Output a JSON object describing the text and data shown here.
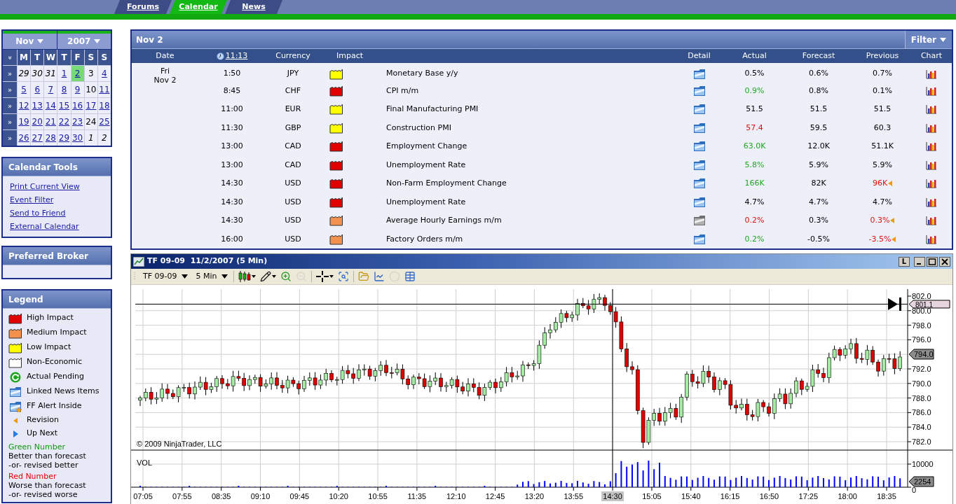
{
  "nav": {
    "tabs": [
      {
        "label": "Forums",
        "selected": false
      },
      {
        "label": "Calendar",
        "selected": true
      },
      {
        "label": "News",
        "selected": false
      }
    ]
  },
  "mini_calendar": {
    "month": "Nov",
    "year": "2007",
    "corner": "»",
    "weekdays": [
      "M",
      "T",
      "W",
      "T",
      "F",
      "S",
      "S"
    ],
    "weeks": [
      {
        "arrow": "»",
        "days": [
          {
            "label": "29",
            "kind": "outside",
            "selected": false
          },
          {
            "label": "30",
            "kind": "outside",
            "selected": false
          },
          {
            "label": "31",
            "kind": "outside",
            "selected": false
          },
          {
            "label": "1",
            "kind": "link",
            "selected": false
          },
          {
            "label": "2",
            "kind": "link",
            "selected": true
          },
          {
            "label": "3",
            "kind": "plain",
            "selected": false
          },
          {
            "label": "4",
            "kind": "link",
            "selected": false
          }
        ]
      },
      {
        "arrow": "»",
        "days": [
          {
            "label": "5",
            "kind": "link",
            "selected": false
          },
          {
            "label": "6",
            "kind": "link",
            "selected": false
          },
          {
            "label": "7",
            "kind": "link",
            "selected": false
          },
          {
            "label": "8",
            "kind": "link",
            "selected": false
          },
          {
            "label": "9",
            "kind": "link",
            "selected": false
          },
          {
            "label": "10",
            "kind": "plain",
            "selected": false
          },
          {
            "label": "11",
            "kind": "link",
            "selected": false
          }
        ]
      },
      {
        "arrow": "»",
        "days": [
          {
            "label": "12",
            "kind": "link",
            "selected": false
          },
          {
            "label": "13",
            "kind": "link",
            "selected": false
          },
          {
            "label": "14",
            "kind": "link",
            "selected": false
          },
          {
            "label": "15",
            "kind": "link",
            "selected": false
          },
          {
            "label": "16",
            "kind": "link",
            "selected": false
          },
          {
            "label": "17",
            "kind": "link",
            "selected": false
          },
          {
            "label": "18",
            "kind": "link",
            "selected": false
          }
        ]
      },
      {
        "arrow": "»",
        "days": [
          {
            "label": "19",
            "kind": "link",
            "selected": false
          },
          {
            "label": "20",
            "kind": "link",
            "selected": false
          },
          {
            "label": "21",
            "kind": "link",
            "selected": false
          },
          {
            "label": "22",
            "kind": "link",
            "selected": false
          },
          {
            "label": "23",
            "kind": "link",
            "selected": false
          },
          {
            "label": "24",
            "kind": "plain",
            "selected": false
          },
          {
            "label": "25",
            "kind": "link",
            "selected": false
          }
        ]
      },
      {
        "arrow": "»",
        "days": [
          {
            "label": "26",
            "kind": "link",
            "selected": false
          },
          {
            "label": "27",
            "kind": "link",
            "selected": false
          },
          {
            "label": "28",
            "kind": "link",
            "selected": false
          },
          {
            "label": "29",
            "kind": "link",
            "selected": false
          },
          {
            "label": "30",
            "kind": "link",
            "selected": false
          },
          {
            "label": "1",
            "kind": "outside",
            "selected": false
          },
          {
            "label": "2",
            "kind": "outside",
            "selected": false
          }
        ]
      }
    ]
  },
  "calendar_tools": {
    "title": "Calendar Tools",
    "links": [
      "Print Current View",
      "Event Filter",
      "Send to Friend",
      "External Calendar"
    ]
  },
  "preferred_broker": {
    "title": "Preferred Broker"
  },
  "legend": {
    "title": "Legend",
    "items": [
      {
        "kind": "impact",
        "color": "#e00000",
        "label": "High Impact"
      },
      {
        "kind": "impact",
        "color": "#f3914f",
        "label": "Medium Impact"
      },
      {
        "kind": "impact",
        "color": "#ffff00",
        "label": "Low Impact"
      },
      {
        "kind": "impact",
        "color": "#ffffff",
        "label": "Non-Economic"
      },
      {
        "kind": "pending",
        "label": "Actual Pending"
      },
      {
        "kind": "news",
        "label": "Linked News Items"
      },
      {
        "kind": "alert",
        "label": "FF Alert Inside"
      },
      {
        "kind": "revision",
        "label": "Revision"
      },
      {
        "kind": "upnext",
        "label": "Up Next"
      },
      {
        "kind": "note",
        "color": "#119911",
        "label": "Green Number",
        "lines": [
          "Better than forecast",
          "-or- revised better"
        ]
      },
      {
        "kind": "note",
        "color": "#e00000",
        "label": "Red Number",
        "lines": [
          "Worse than forecast",
          "-or- revised worse"
        ]
      }
    ]
  },
  "events": {
    "title": "Nov 2",
    "filter": "Filter",
    "columns": {
      "date": "Date",
      "time": "11:13",
      "currency": "Currency",
      "impact": "Impact",
      "detail": "Detail",
      "actual": "Actual",
      "forecast": "Forecast",
      "previous": "Previous",
      "chart": "Chart"
    },
    "rows": [
      {
        "day": "Fri",
        "date": "Nov 2",
        "time": "1:50",
        "currency": "JPY",
        "impact": {
          "color": "#ffff00"
        },
        "event": "Monetary Base y/y",
        "detail_dim": false,
        "actual": {
          "value": "0.5%",
          "color": "#000000"
        },
        "forecast": "0.6%",
        "previous": {
          "value": "0.7%",
          "color": "#000000",
          "revised": false
        }
      },
      {
        "time": "8:45",
        "currency": "CHF",
        "impact": {
          "color": "#e00000"
        },
        "event": "CPI m/m",
        "detail_dim": false,
        "actual": {
          "value": "0.9%",
          "color": "#22a822"
        },
        "forecast": "0.8%",
        "previous": {
          "value": "0.1%",
          "color": "#000000",
          "revised": false
        }
      },
      {
        "time": "11:00",
        "currency": "EUR",
        "impact": {
          "color": "#ffff00"
        },
        "event": "Final Manufacturing PMI",
        "detail_dim": false,
        "actual": {
          "value": "51.5",
          "color": "#000000"
        },
        "forecast": "51.5",
        "previous": {
          "value": "51.5",
          "color": "#000000",
          "revised": false
        }
      },
      {
        "time": "11:30",
        "currency": "GBP",
        "impact": {
          "color": "#ffff00"
        },
        "event": "Construction PMI",
        "detail_dim": false,
        "actual": {
          "value": "57.4",
          "color": "#e01010"
        },
        "forecast": "59.5",
        "previous": {
          "value": "60.3",
          "color": "#000000",
          "revised": false
        }
      },
      {
        "time": "13:00",
        "currency": "CAD",
        "impact": {
          "color": "#e00000"
        },
        "event": "Employment Change",
        "detail_dim": false,
        "actual": {
          "value": "63.0K",
          "color": "#22a822"
        },
        "forecast": "12.0K",
        "previous": {
          "value": "51.1K",
          "color": "#000000",
          "revised": false
        }
      },
      {
        "time": "13:00",
        "currency": "CAD",
        "impact": {
          "color": "#e00000"
        },
        "event": "Unemployment Rate",
        "detail_dim": false,
        "actual": {
          "value": "5.8%",
          "color": "#22a822"
        },
        "forecast": "5.9%",
        "previous": {
          "value": "5.9%",
          "color": "#000000",
          "revised": false
        }
      },
      {
        "time": "14:30",
        "currency": "USD",
        "impact": {
          "color": "#e00000"
        },
        "event": "Non-Farm Employment Change",
        "detail_dim": false,
        "actual": {
          "value": "166K",
          "color": "#22a822"
        },
        "forecast": "82K",
        "previous": {
          "value": "96K",
          "color": "#e01010",
          "revised": true
        }
      },
      {
        "time": "14:30",
        "currency": "USD",
        "impact": {
          "color": "#e00000"
        },
        "event": "Unemployment Rate",
        "detail_dim": false,
        "actual": {
          "value": "4.7%",
          "color": "#000000"
        },
        "forecast": "4.7%",
        "previous": {
          "value": "4.7%",
          "color": "#000000",
          "revised": false
        }
      },
      {
        "time": "14:30",
        "currency": "USD",
        "impact": {
          "color": "#f3914f"
        },
        "event": "Average Hourly Earnings m/m",
        "detail_dim": true,
        "actual": {
          "value": "0.2%",
          "color": "#e01010"
        },
        "forecast": "0.3%",
        "previous": {
          "value": "0.3%",
          "color": "#e01010",
          "revised": true
        }
      },
      {
        "time": "16:00",
        "currency": "USD",
        "impact": {
          "color": "#f3914f"
        },
        "event": "Factory Orders m/m",
        "detail_dim": false,
        "actual": {
          "value": "0.2%",
          "color": "#22a822"
        },
        "forecast": "-0.5%",
        "previous": {
          "value": "-3.5%",
          "color": "#e01010",
          "revised": true
        }
      }
    ]
  },
  "chart_window": {
    "title": "TF 09-09  11/2/2007 (5 Min)",
    "layout_button": "L",
    "instrument": "TF 09-09",
    "interval": "5 Min",
    "tool_groups": [
      [
        {
          "kind": "candles",
          "menu": true,
          "disabled": false
        },
        {
          "kind": "pencil",
          "menu": true,
          "disabled": false
        },
        {
          "kind": "zoom-in",
          "menu": false,
          "disabled": false
        },
        {
          "kind": "zoom-out",
          "menu": false,
          "disabled": true
        }
      ],
      [
        {
          "kind": "crosshair",
          "menu": true,
          "disabled": false
        },
        {
          "kind": "zoom-box",
          "menu": false,
          "disabled": false
        }
      ],
      [
        {
          "kind": "data-box",
          "menu": false,
          "disabled": false
        },
        {
          "kind": "indicator",
          "menu": false,
          "disabled": false
        },
        {
          "kind": "strategy",
          "menu": false,
          "disabled": true
        },
        {
          "kind": "table",
          "menu": false,
          "disabled": false
        }
      ]
    ],
    "y_ticks": [
      "802.0",
      "800.0",
      "798.0",
      "796.0",
      "792.0",
      "790.0",
      "788.0",
      "786.0",
      "784.0",
      "782.0"
    ],
    "x_ticks": [
      {
        "label": "07:05",
        "selected": false
      },
      {
        "label": "07:55",
        "selected": false
      },
      {
        "label": "08:35",
        "selected": false
      },
      {
        "label": "09:10",
        "selected": false
      },
      {
        "label": "09:45",
        "selected": false
      },
      {
        "label": "10:20",
        "selected": false
      },
      {
        "label": "10:55",
        "selected": false
      },
      {
        "label": "11:35",
        "selected": false
      },
      {
        "label": "12:10",
        "selected": false
      },
      {
        "label": "12:45",
        "selected": false
      },
      {
        "label": "13:20",
        "selected": false
      },
      {
        "label": "13:55",
        "selected": false
      },
      {
        "label": "14:30",
        "selected": true
      },
      {
        "label": "15:05",
        "selected": false
      },
      {
        "label": "15:40",
        "selected": false
      },
      {
        "label": "16:15",
        "selected": false
      },
      {
        "label": "16:50",
        "selected": false
      },
      {
        "label": "17:25",
        "selected": false
      },
      {
        "label": "18:00",
        "selected": false
      },
      {
        "label": "18:35",
        "selected": false
      }
    ],
    "crosshair_price": "801.1",
    "last_price": "794.0",
    "copyright": "© 2009 NinjaTrader, LLC",
    "volume_label": "VOL",
    "volume_tick": "10000",
    "volume_zero": "0",
    "last_volume": "2254"
  }
}
